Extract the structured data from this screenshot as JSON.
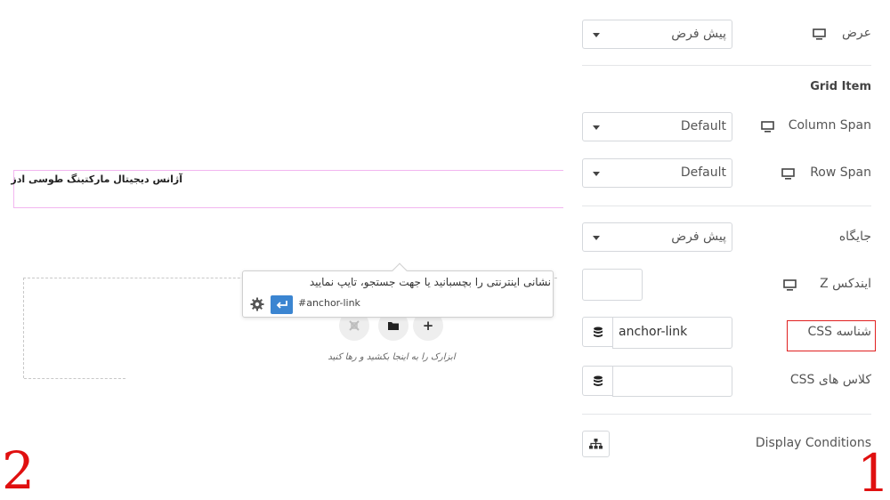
{
  "canvas": {
    "heading_text": "آژانس دیجیتال مارکتینگ طوسی ادز",
    "drop_hint": "ابزارک را به اینجا بکشید و رها کنید",
    "buttons": {
      "add": "+",
      "folder": "folder",
      "template": "template"
    }
  },
  "link_popover": {
    "placeholder": "نشانی اینترنتی را بچسبانید یا جهت جستجو، تایپ نمایید",
    "value": "#anchor-link",
    "enter_icon": "enter-icon",
    "settings_icon": "gear-icon"
  },
  "panel": {
    "width": {
      "label": "عرض",
      "value": "پیش فرض"
    },
    "grid_item": {
      "title": "Grid Item",
      "column_span": {
        "label": "Column Span",
        "value": "Default"
      },
      "row_span": {
        "label": "Row Span",
        "value": "Default"
      }
    },
    "position": {
      "label": "جایگاه",
      "value": "پیش فرض"
    },
    "z_index": {
      "label": "ایندکس Z",
      "value": ""
    },
    "css_id": {
      "label": "شناسه CSS",
      "value": "anchor-link"
    },
    "css_classes": {
      "label": "کلاس های CSS",
      "value": ""
    },
    "display_conditions": {
      "label": "Display Conditions"
    }
  },
  "annotations": {
    "marker_1": "1",
    "marker_2": "2"
  },
  "colors": {
    "accent_blue": "#3b85d1",
    "highlight_red": "#e02020",
    "marker_red": "#e01010",
    "heading_border": "#f2b6f0"
  }
}
